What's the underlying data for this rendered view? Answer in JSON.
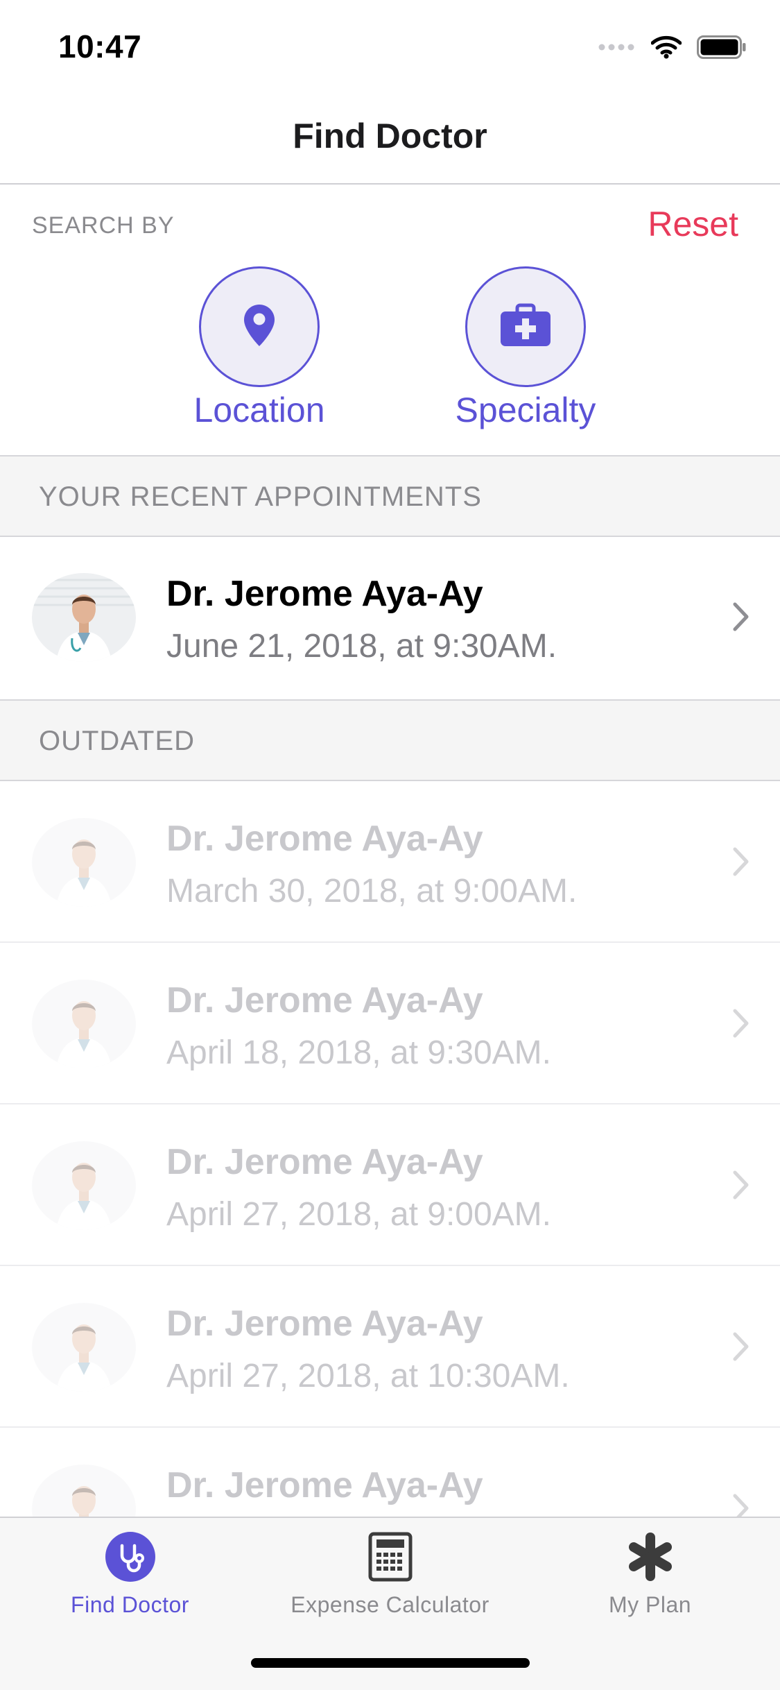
{
  "status_bar": {
    "time": "10:47",
    "icons": [
      "cellular-signal-icon",
      "wifi-icon",
      "battery-icon"
    ]
  },
  "nav": {
    "title": "Find Doctor"
  },
  "search": {
    "label": "SEARCH BY",
    "reset_label": "Reset",
    "options": [
      {
        "label": "Location",
        "icon": "location-pin-icon"
      },
      {
        "label": "Specialty",
        "icon": "medical-kit-icon"
      }
    ]
  },
  "recent": {
    "header": "YOUR RECENT APPOINTMENTS",
    "items": [
      {
        "name": "Dr. Jerome Aya-Ay",
        "date": "June 21, 2018, at 9:30AM."
      }
    ]
  },
  "outdated": {
    "header": "OUTDATED",
    "items": [
      {
        "name": "Dr. Jerome Aya-Ay",
        "date": "March 30, 2018, at 9:00AM."
      },
      {
        "name": "Dr. Jerome Aya-Ay",
        "date": "April 18, 2018, at 9:30AM."
      },
      {
        "name": "Dr. Jerome Aya-Ay",
        "date": "April 27, 2018, at 9:00AM."
      },
      {
        "name": "Dr. Jerome Aya-Ay",
        "date": "April 27, 2018, at 10:30AM."
      },
      {
        "name": "Dr. Jerome Aya-Ay",
        "date": ""
      }
    ]
  },
  "tabs": [
    {
      "label": "Find Doctor",
      "icon": "stethoscope-icon",
      "active": true
    },
    {
      "label": "Expense Calculator",
      "icon": "calculator-icon",
      "active": false
    },
    {
      "label": "My Plan",
      "icon": "asterisk-icon",
      "active": false
    }
  ],
  "colors": {
    "accent": "#5b52d6",
    "reset": "#e83a5a",
    "secondary_text": "#8a8a8e"
  }
}
